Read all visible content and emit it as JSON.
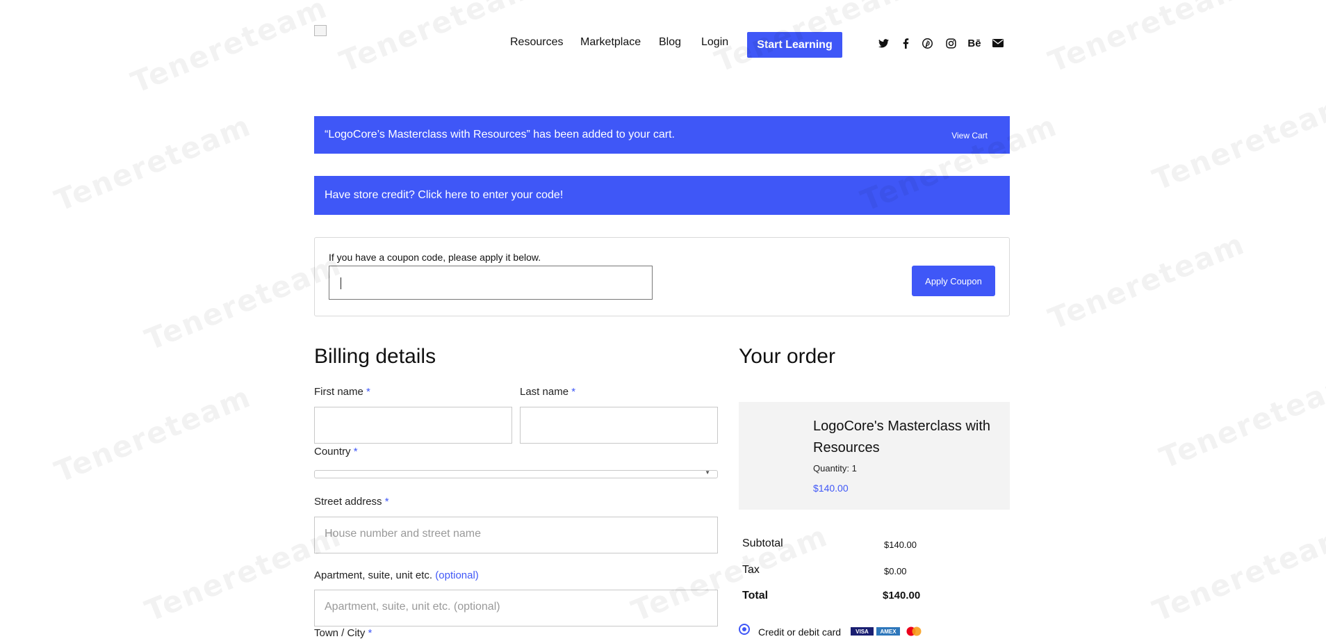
{
  "header": {
    "nav": [
      "Resources",
      "Marketplace",
      "Blog",
      "Login"
    ],
    "cta_label": "Start Learning",
    "social_icons": [
      "twitter-icon",
      "facebook-icon",
      "pinterest-icon",
      "instagram-icon",
      "behance-icon",
      "envelope-icon"
    ],
    "behance_glyph": "Bē"
  },
  "notices": {
    "added_to_cart": "“LogoCore’s Masterclass with Resources” has been added to your cart.",
    "view_cart": "View Cart",
    "store_credit": "Have store credit? Click here to enter your code!"
  },
  "coupon": {
    "label": "If you have a coupon code, please apply it below.",
    "value": "",
    "button": "Apply Coupon"
  },
  "billing": {
    "title": "Billing details",
    "required_mark": "*",
    "first_name_label": "First name",
    "last_name_label": "Last name",
    "country_label": "Country",
    "street_label": "Street address",
    "street_placeholder": "House number and street name",
    "apartment_label": "Apartment, suite, unit etc.",
    "apartment_optional": "(optional)",
    "apartment_placeholder": "Apartment, suite, unit etc. (optional)",
    "town_label": "Town / City"
  },
  "order": {
    "title": "Your order",
    "product_name": "LogoCore's Masterclass with Resources",
    "quantity": "Quantity: 1",
    "price": "$140.00",
    "subtotal_label": "Subtotal",
    "subtotal": "$140.00",
    "tax_label": "Tax",
    "tax": "$0.00",
    "total_label": "Total",
    "total": "$140.00",
    "payment_label": "Credit or debit card",
    "card_brands": [
      "VISA",
      "AMEX"
    ]
  },
  "watermark": "Tenereteam",
  "colors": {
    "accent": "#3f57f7",
    "order_bg": "#f3f3f3"
  }
}
